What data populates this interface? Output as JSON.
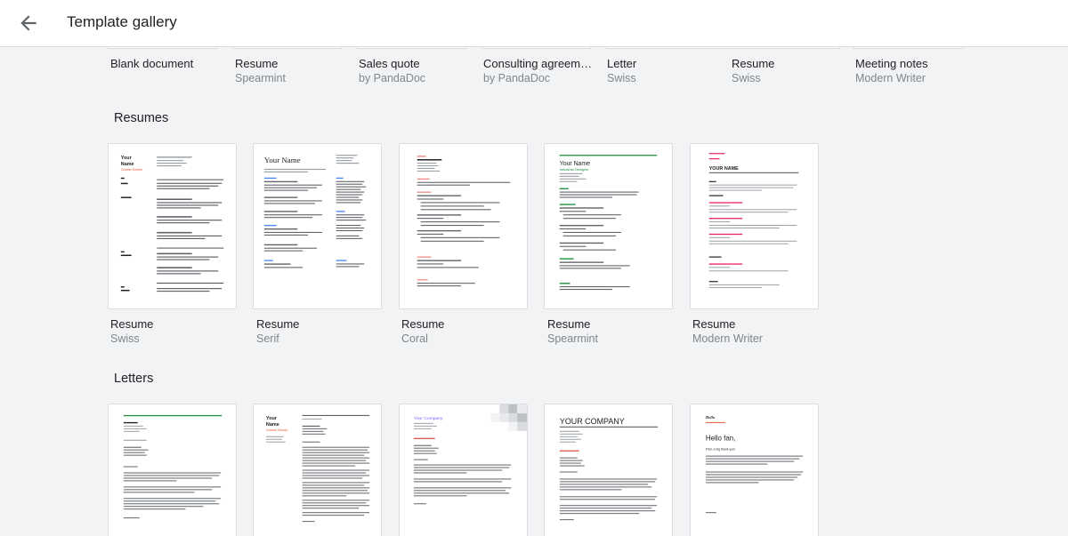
{
  "header": {
    "title": "Template gallery",
    "back_icon": "arrow-back-icon"
  },
  "recent": [
    {
      "name": "Blank document",
      "sub": ""
    },
    {
      "name": "Resume",
      "sub": "Spearmint"
    },
    {
      "name": "Sales quote",
      "sub": "by PandaDoc"
    },
    {
      "name": "Consulting agreem…",
      "sub": "by PandaDoc"
    },
    {
      "name": "Letter",
      "sub": "Swiss"
    },
    {
      "name": "Resume",
      "sub": "Swiss"
    },
    {
      "name": "Meeting notes",
      "sub": "Modern Writer"
    }
  ],
  "resumes": {
    "heading": "Resumes",
    "items": [
      {
        "name": "Resume",
        "sub": "Swiss",
        "accent": "#e8542e"
      },
      {
        "name": "Resume",
        "sub": "Serif",
        "accent": "#4285f4"
      },
      {
        "name": "Resume",
        "sub": "Coral",
        "accent": "#f28b82"
      },
      {
        "name": "Resume",
        "sub": "Spearmint",
        "accent": "#1e8e3e"
      },
      {
        "name": "Resume",
        "sub": "Modern Writer",
        "accent": "#e91e63"
      }
    ],
    "thumb_text": {
      "your_name": "Your Name",
      "your_name_split_1": "Your",
      "your_name_split_2": "Name",
      "creative_director": "Creative Director",
      "industrial_designer": "Industrial Designer",
      "i_m_your_name": "Hello",
      "your_name_upper": "YOUR NAME"
    }
  },
  "letters": {
    "heading": "Letters",
    "thumb_text": {
      "your_name_split_1": "Your",
      "your_name_split_2": "Name",
      "creative_director": "Creative Director",
      "your_company": "Your Company",
      "your_company_upper": "YOUR COMPANY",
      "hello_fan": "Hello fan,",
      "first_big_thank_you": "First, a big thank you!"
    }
  },
  "colors": {
    "accent_green": "#1e8e3e",
    "accent_orange": "#e8542e",
    "accent_purple": "#7b61ff",
    "accent_red": "#d93025"
  }
}
